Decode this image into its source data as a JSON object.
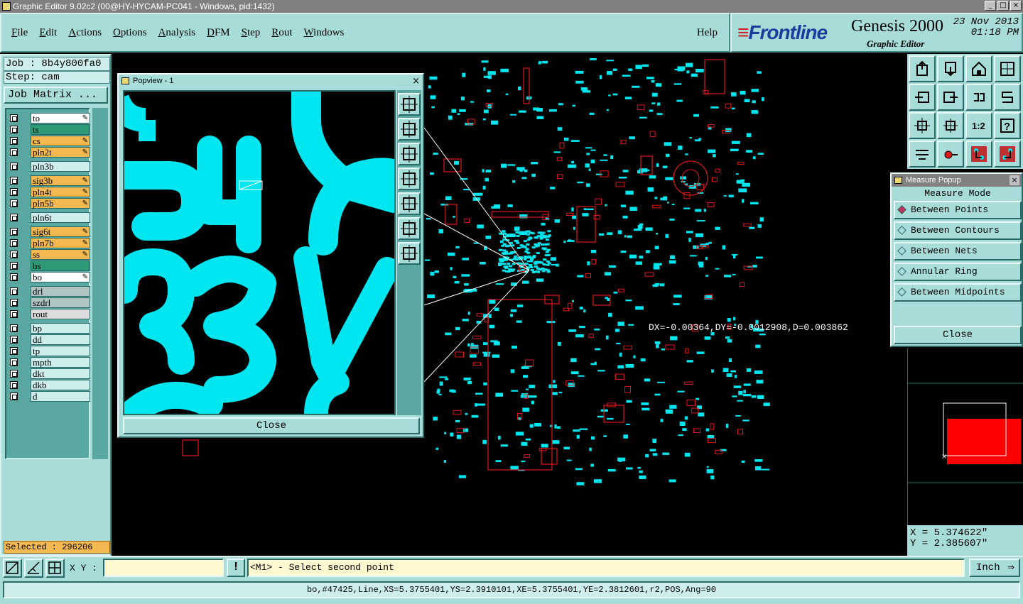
{
  "window": {
    "title": "Graphic Editor 9.02c2 (00@HY-HYCAM-PC041 - Windows, pid:1432)",
    "controls": [
      "_",
      "□",
      "×"
    ]
  },
  "menu": {
    "items": [
      "File",
      "Edit",
      "Actions",
      "Options",
      "Analysis",
      "DFM",
      "Step",
      "Rout",
      "Windows"
    ],
    "help": "Help"
  },
  "brand": {
    "logo": "Frontline",
    "product": "Genesis 2000",
    "subtitle": "Graphic Editor",
    "date": "23 Nov 2013",
    "time": "01:18 PM"
  },
  "job": {
    "job_label": "Job : 8b4y800fa0",
    "step_label": "Step: cam",
    "matrix_button": "Job Matrix ..."
  },
  "layers": [
    {
      "name": "to",
      "color": "#ffffff",
      "pen": "✎"
    },
    {
      "name": "ts",
      "color": "#2e9a78",
      "pen": ""
    },
    {
      "name": "cs",
      "color": "#f4b850",
      "pen": "✎"
    },
    {
      "name": "pln2t",
      "color": "#f4b850",
      "pen": "✎"
    },
    {
      "name": "pln3b",
      "color": "#cdeeec",
      "pen": ""
    },
    {
      "name": "sig3b",
      "color": "#f4b850",
      "pen": "✎"
    },
    {
      "name": "pln4t",
      "color": "#f4b850",
      "pen": "✎"
    },
    {
      "name": "pln5b",
      "color": "#f4b850",
      "pen": "✎"
    },
    {
      "name": "pln6t",
      "color": "#cdeeec",
      "pen": ""
    },
    {
      "name": "sig6t",
      "color": "#f4b850",
      "pen": "✎"
    },
    {
      "name": "pln7b",
      "color": "#f4b850",
      "pen": "✎"
    },
    {
      "name": "ss",
      "color": "#f4b850",
      "pen": "✎"
    },
    {
      "name": "bs",
      "color": "#2e9a78",
      "pen": ""
    },
    {
      "name": "bo",
      "color": "#ffffff",
      "pen": "✎"
    },
    {
      "name": "drl",
      "color": "#b0c4c4",
      "pen": ""
    },
    {
      "name": "szdrl",
      "color": "#b0c4c4",
      "pen": ""
    },
    {
      "name": "rout",
      "color": "#dcdcdc",
      "pen": ""
    },
    {
      "name": "bp",
      "color": "#cdeeec",
      "pen": ""
    },
    {
      "name": "dd",
      "color": "#cdeeec",
      "pen": ""
    },
    {
      "name": "tp",
      "color": "#cdeeec",
      "pen": ""
    },
    {
      "name": "mpth",
      "color": "#cdeeec",
      "pen": ""
    },
    {
      "name": "dkt",
      "color": "#cdeeec",
      "pen": ""
    },
    {
      "name": "dkb",
      "color": "#cdeeec",
      "pen": ""
    },
    {
      "name": "d",
      "color": "#cdeeec",
      "pen": ""
    }
  ],
  "selected": "Selected : 296206",
  "canvas": {
    "measure_readout": "DX=-0.00364,DY=-0.0012908,D=0.003862"
  },
  "popview": {
    "title": "Popview - 1",
    "close": "Close",
    "close_x": "×",
    "tools": [
      "zoom-fit-icon",
      "pan-up-icon",
      "pan-down-icon",
      "pan-left-icon",
      "pan-right-icon",
      "zoom-extent-icon",
      "zoom-home-icon"
    ]
  },
  "measure_popup": {
    "title": "Measure Popup",
    "close_x": "×",
    "mode_heading": "Measure Mode",
    "options": [
      "Between Points",
      "Between Contours",
      "Between Nets",
      "Annular Ring",
      "Between Midpoints"
    ],
    "selected_option": "Between Points",
    "close": "Close"
  },
  "coords": {
    "x": "X = 5.374622\"",
    "y": "Y = 2.385607\""
  },
  "bottom": {
    "xy_label": "X Y :",
    "xy_value": "",
    "excl": "!",
    "prompt": "<M1> - Select second point",
    "units": "Inch",
    "units_arrow": "⇒",
    "status": "bo,#47425,Line,XS=5.3755401,YS=2.3910101,XE=5.3755401,YE=2.3812601,r2,POS,Ang=90"
  },
  "colors": {
    "panel": "#a8dcd8",
    "pcb_cyan": "#00e6f0",
    "pcb_red": "#e01818"
  }
}
